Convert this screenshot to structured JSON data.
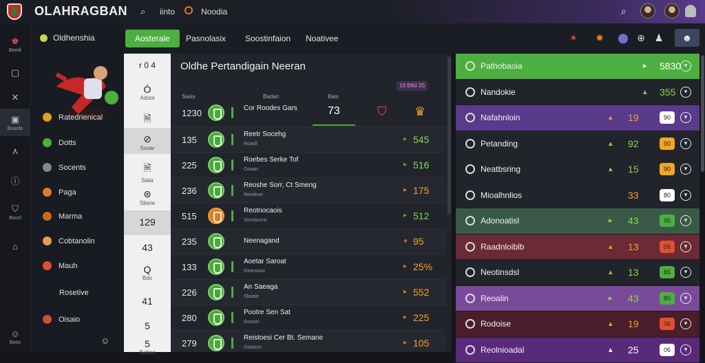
{
  "topbar": {
    "title": "OLAHRAGBAN",
    "search_label": "iinto",
    "news_label": "Noodia"
  },
  "sidebar": {
    "items": [
      {
        "icon": "trophy-icon",
        "caption": "Beedi"
      },
      {
        "icon": "card-icon",
        "caption": ""
      },
      {
        "icon": "cross-icon",
        "caption": ""
      },
      {
        "icon": "video-icon",
        "caption": "Boords"
      },
      {
        "icon": "net-icon",
        "caption": ""
      },
      {
        "icon": "info-icon",
        "caption": ""
      },
      {
        "icon": "shield-icon",
        "caption": "Bocel"
      },
      {
        "icon": "home-icon",
        "caption": ""
      },
      {
        "icon": "user-icon",
        "caption": "Boos"
      }
    ]
  },
  "leftpanel": {
    "header": "Oldhenshia",
    "items": [
      {
        "label": "Ratedrienical",
        "color": "#e0a020"
      },
      {
        "label": "Dotts",
        "color": "#4caf3f"
      },
      {
        "label": "Socents",
        "color": "#888888"
      },
      {
        "label": "Paga",
        "color": "#e07a2a"
      },
      {
        "label": "Marma",
        "color": "#c86a1a"
      },
      {
        "label": "Cobtanolin",
        "color": "#e0a050"
      },
      {
        "label": "Mauh",
        "color": "#e05030"
      },
      {
        "label": "Rosetive",
        "color": ""
      },
      {
        "label": "Oisaio",
        "color": "#c8503a"
      }
    ]
  },
  "tabs": [
    {
      "label": "Aosterale",
      "active": true
    },
    {
      "label": "Pasnolasix",
      "active": false
    },
    {
      "label": "Soostinfaion",
      "active": false
    },
    {
      "label": "Noativee",
      "active": false
    }
  ],
  "numcol": {
    "top": "r 0 4",
    "cells": [
      {
        "value": "Ó",
        "sub": "Adoot"
      },
      {
        "value": "🗎",
        "sub": ""
      },
      {
        "value": "⊘",
        "sub": "Sooar"
      },
      {
        "value": "🗎",
        "sub": "Siaia"
      },
      {
        "value": "⊛",
        "sub": "Sliarie"
      },
      {
        "value": "129",
        "sub": ""
      },
      {
        "value": "43",
        "sub": ""
      },
      {
        "value": "Q",
        "sub": "Bdo"
      },
      {
        "value": "41",
        "sub": ""
      },
      {
        "value": "5",
        "sub": ""
      },
      {
        "value": "5",
        "sub": "Baboo"
      }
    ]
  },
  "main": {
    "title": "Oldhe Pertandigain Neeran",
    "headers": [
      "Sasis",
      "Badan",
      "Bais"
    ],
    "badge": "19 B8d 3S",
    "featured": {
      "time": "1230",
      "team": "Cor Roodes Gars",
      "score": "73"
    },
    "rows": [
      {
        "time": "135",
        "name": "Reetr Socehg",
        "sub": "Roaidl",
        "odd": "545",
        "arrow": "▸",
        "arrowColor": "#4caf3f",
        "oddColor": "#8ad64a"
      },
      {
        "time": "225",
        "name": "Roebes Serke Tof",
        "sub": "Ooaan",
        "odd": "516",
        "arrow": "▸",
        "arrowColor": "#4caf3f",
        "oddColor": "#8ad64a"
      },
      {
        "time": "236",
        "name": "Reoshe Sorr, Ct Smeng",
        "sub": "Reodose",
        "odd": "175",
        "arrow": "▸",
        "arrowColor": "#e07a2a",
        "oddColor": "#f2a623"
      },
      {
        "time": "515",
        "name": "Reotnocaois",
        "sub": "Sonokurne",
        "odd": "512",
        "arrow": "▸",
        "arrowColor": "#4caf3f",
        "oddColor": "#8ad64a"
      },
      {
        "time": "235",
        "name": "Neenagand",
        "sub": "",
        "odd": "95",
        "arrow": "●",
        "arrowColor": "#e05030",
        "oddColor": "#f2a623"
      },
      {
        "time": "133",
        "name": "Aoetar Saroat",
        "sub": "Oearsiara",
        "odd": "25%",
        "arrow": "▸",
        "arrowColor": "#e07a2a",
        "oddColor": "#f2a623"
      },
      {
        "time": "226",
        "name": "An Saeaga",
        "sub": "Sbaaie",
        "odd": "552",
        "arrow": "▸",
        "arrowColor": "#e07a2a",
        "oddColor": "#f2a623"
      },
      {
        "time": "280",
        "name": "Pootre Sen Sat",
        "sub": "Ooosel",
        "odd": "225",
        "arrow": "▸",
        "arrowColor": "#e07a2a",
        "oddColor": "#f2a623"
      },
      {
        "time": "279",
        "name": "Reistoesi Cer Bt. Semane",
        "sub": "Ooasurs",
        "odd": "105",
        "arrow": "▸",
        "arrowColor": "#e07a2a",
        "oddColor": "#f2a623"
      }
    ]
  },
  "right": {
    "rows": [
      {
        "label": "Pathobaoia",
        "arrow": "▸",
        "val": "5830",
        "chip": "",
        "bg": "#4caf3f",
        "valColor": "#ffffff",
        "chipColor": ""
      },
      {
        "label": "Nandokie",
        "arrow": "▴",
        "val": "355",
        "chip": "",
        "bg": "#22242c",
        "valColor": "#8ad64a",
        "chipColor": ""
      },
      {
        "label": "Nafahnloin",
        "arrow": "▴",
        "val": "19",
        "chip": "90",
        "bg": "#5a3a8a",
        "valColor": "#f2a623",
        "chipColor": "#ffffff"
      },
      {
        "label": "Petanding",
        "arrow": "▴",
        "val": "92",
        "chip": "90",
        "bg": "#22242c",
        "valColor": "#8ad64a",
        "chipColor": "#f2a623"
      },
      {
        "label": "Neatbsring",
        "arrow": "▴",
        "val": "15",
        "chip": "90",
        "bg": "#22242c",
        "valColor": "#8ad64a",
        "chipColor": "#f2a623"
      },
      {
        "label": "Mioalhnlios",
        "arrow": "",
        "val": "33",
        "chip": "80",
        "bg": "#22242c",
        "valColor": "#f2a623",
        "chipColor": "#ffffff"
      },
      {
        "label": "Adonoatisl",
        "arrow": "▸",
        "val": "43",
        "chip": "95",
        "bg": "#3a5a48",
        "valColor": "#8ad64a",
        "chipColor": ""
      },
      {
        "label": "Raadnloiblb",
        "arrow": "▴",
        "val": "13",
        "chip": "06",
        "bg": "#6a2a36",
        "valColor": "#f2a623",
        "chipColor": "#e05030"
      },
      {
        "label": "Neotinsdsl",
        "arrow": "▴",
        "val": "13",
        "chip": "85",
        "bg": "#22242c",
        "valColor": "#8ad64a",
        "chipColor": "#4caf3f"
      },
      {
        "label": "Reoalin",
        "arrow": "▸",
        "val": "43",
        "chip": "80",
        "bg": "#7a4a9a",
        "valColor": "#8ad64a",
        "chipColor": "#4caf3f"
      },
      {
        "label": "Rodoise",
        "arrow": "▴",
        "val": "19",
        "chip": "06",
        "bg": "#4a1e2a",
        "valColor": "#f2a623",
        "chipColor": "#e05030"
      },
      {
        "label": "Reolnioadal",
        "arrow": "▴",
        "val": "25",
        "chip": "06",
        "bg": "#5a2a7a",
        "valColor": "#ffffff",
        "chipColor": "#ffffff"
      }
    ]
  },
  "colors": {
    "accent": "#4caf3f",
    "purple": "#5a3a8a",
    "orange": "#f2a623"
  }
}
